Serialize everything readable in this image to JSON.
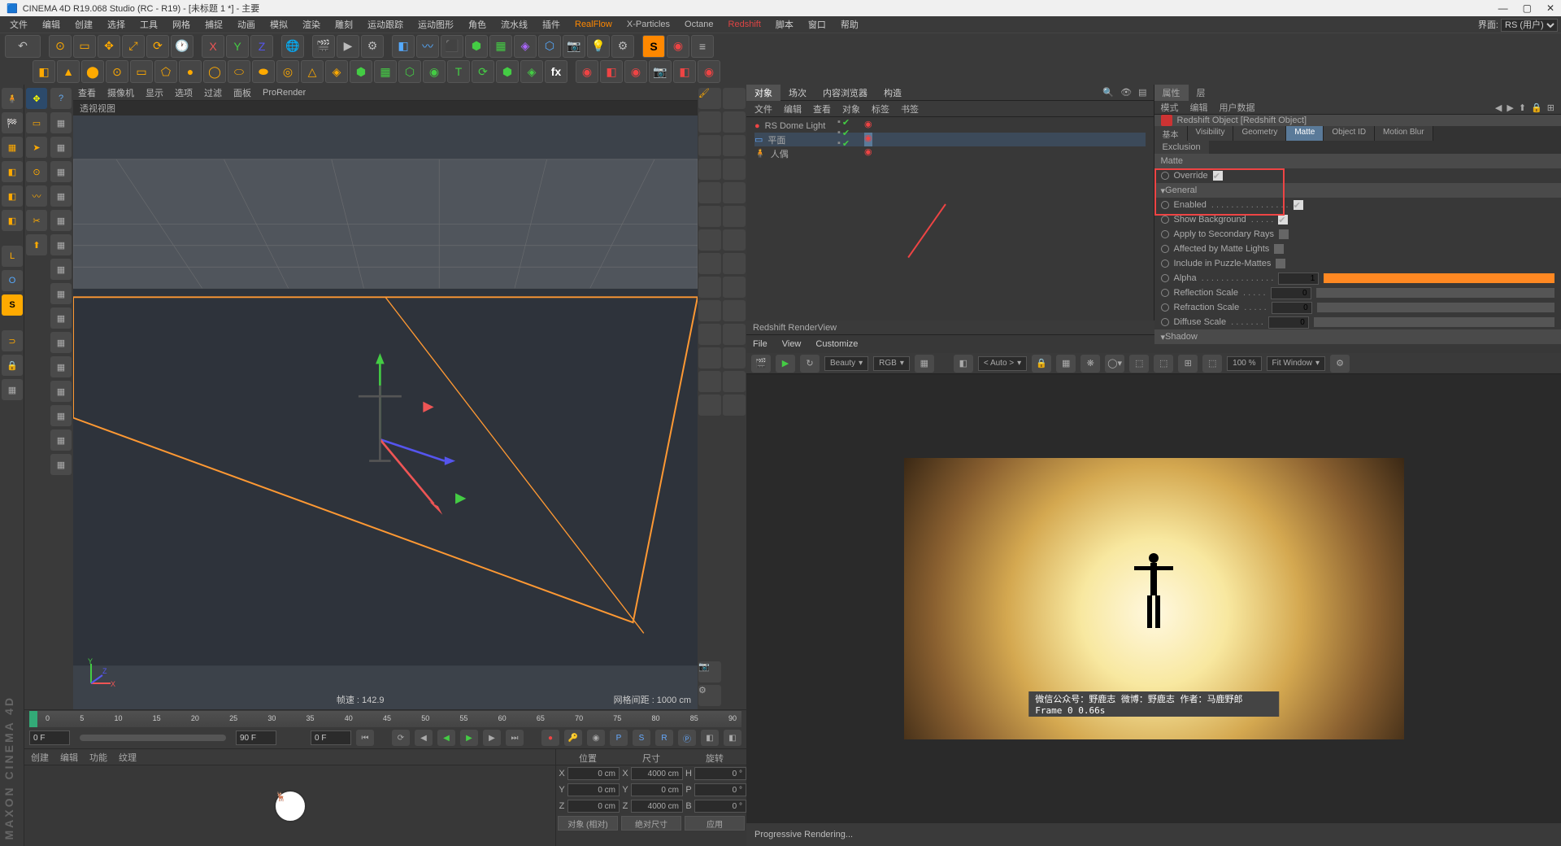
{
  "titlebar": {
    "title": "CINEMA 4D R19.068 Studio (RC - R19) - [未标题 1 *] - 主要"
  },
  "menubar": {
    "items": [
      "文件",
      "编辑",
      "创建",
      "选择",
      "工具",
      "网格",
      "捕捉",
      "动画",
      "模拟",
      "渲染",
      "雕刻",
      "运动跟踪",
      "运动图形",
      "角色",
      "流水线",
      "插件"
    ],
    "plugins": [
      "RealFlow",
      "X-Particles",
      "Octane",
      "Redshift"
    ],
    "items2": [
      "脚本",
      "窗口",
      "帮助"
    ],
    "layout_label": "界面:",
    "layout_value": "RS (用户)"
  },
  "vp_menu": [
    "查看",
    "摄像机",
    "显示",
    "选项",
    "过滤",
    "面板",
    "ProRender"
  ],
  "vp_title": "透视视图",
  "vp_fps": "帧速 : 142.9",
  "vp_grid": "网格间距 : 1000 cm",
  "timeline": {
    "start": "0 F",
    "cur": "0 F",
    "end": "90 F",
    "marks": [
      "0",
      "5",
      "10",
      "15",
      "20",
      "25",
      "30",
      "35",
      "40",
      "45",
      "50",
      "55",
      "60",
      "65",
      "70",
      "75",
      "80",
      "85",
      "90"
    ]
  },
  "matpanel": {
    "tabs": [
      "创建",
      "编辑",
      "功能",
      "纹理"
    ]
  },
  "coord": {
    "hdr": [
      "位置",
      "尺寸",
      "旋转"
    ],
    "rows": [
      {
        "a": "X",
        "p": "0 cm",
        "s": "4000 cm",
        "r": "H",
        "rv": "0 °"
      },
      {
        "a": "Y",
        "p": "0 cm",
        "s": "0 cm",
        "r": "P",
        "rv": "0 °"
      },
      {
        "a": "Z",
        "p": "0 cm",
        "s": "4000 cm",
        "r": "B",
        "rv": "0 °"
      }
    ],
    "btn1": "对象 (相对)",
    "btn2": "绝对尺寸",
    "btn3": "应用"
  },
  "om": {
    "tabs": [
      "对象",
      "场次",
      "内容浏览器",
      "构造"
    ],
    "menu": [
      "文件",
      "编辑",
      "查看",
      "对象",
      "标签",
      "书签"
    ],
    "rows": [
      {
        "name": "RS Dome Light",
        "color": "#e44"
      },
      {
        "name": "平面",
        "color": "#6af",
        "sel": true
      },
      {
        "name": "人偶",
        "color": "#fa6"
      }
    ]
  },
  "attr": {
    "tabs": [
      "属性",
      "层"
    ],
    "menu": [
      "模式",
      "编辑",
      "用户数据"
    ],
    "title": "Redshift Object [Redshift Object]",
    "tabs2": [
      "基本",
      "Visibility",
      "Geometry",
      "Matte",
      "Object ID",
      "Motion Blur"
    ],
    "tabs2b": [
      "Exclusion"
    ],
    "sect_matte": "Matte",
    "override": "Override",
    "sect_general": "General",
    "rows": [
      {
        "label": "Enabled",
        "chk": true
      },
      {
        "label": "Show Background",
        "chk": true
      },
      {
        "label": "Apply to Secondary Rays",
        "chk": false
      },
      {
        "label": "Affected by Matte Lights",
        "chk": false
      },
      {
        "label": "Include in Puzzle-Mattes",
        "chk": false
      }
    ],
    "alpha_label": "Alpha",
    "alpha_val": "1",
    "scales": [
      {
        "label": "Reflection Scale",
        "val": "0"
      },
      {
        "label": "Refraction Scale",
        "val": "0"
      },
      {
        "label": "Diffuse Scale",
        "val": "0"
      }
    ],
    "sect_shadow": "Shadow"
  },
  "rv": {
    "title": "Redshift RenderView",
    "menu": [
      "File",
      "View",
      "Customize"
    ],
    "beauty": "Beauty",
    "rgb": "RGB",
    "auto": "< Auto >",
    "zoom": "100 %",
    "fit": "Fit Window",
    "anno": "微信公众号：野鹿志  微博：野鹿志  作者：马鹿野郎  Frame  0  0.66s",
    "footer": "Progressive Rendering..."
  },
  "brand": "MAXON CINEMA 4D"
}
